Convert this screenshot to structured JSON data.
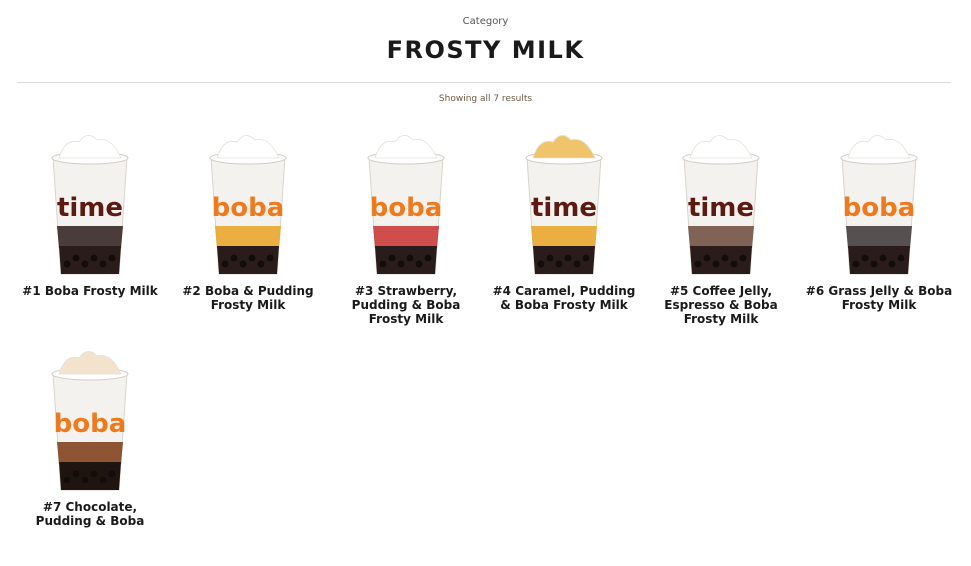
{
  "header": {
    "eyebrow": "Category",
    "title": "FROSTY MILK",
    "results": "Showing all 7 results"
  },
  "products": [
    {
      "name": "#1 Boba Frosty Milk",
      "cup_text": "time",
      "cup_text_color": "#5b1a12",
      "layers": [
        "#2a1c1a",
        "#2a1c1a"
      ],
      "topping_color": "#ffffff"
    },
    {
      "name": "#2 Boba & Pudding Frosty Milk",
      "cup_text": "boba",
      "cup_text_color": "#ef7a1e",
      "layers": [
        "#e8a321",
        "#2a1c1a"
      ],
      "topping_color": "#ffffff"
    },
    {
      "name": "#3 Strawberry, Pudding & Boba Frosty Milk",
      "cup_text": "boba",
      "cup_text_color": "#ef7a1e",
      "layers": [
        "#c8302e",
        "#2a1c1a"
      ],
      "topping_color": "#ffffff"
    },
    {
      "name": "#4 Caramel, Pudding & Boba Frosty Milk",
      "cup_text": "time",
      "cup_text_color": "#5b1a12",
      "layers": [
        "#e8a321",
        "#2a1c1a"
      ],
      "topping_color": "#f0c46a"
    },
    {
      "name": "#5 Coffee Jelly, Espresso & Boba Frosty Milk",
      "cup_text": "time",
      "cup_text_color": "#5b1a12",
      "layers": [
        "#6b4a3a",
        "#2a1c1a"
      ],
      "topping_color": "#ffffff"
    },
    {
      "name": "#6 Grass Jelly & Boba Frosty Milk",
      "cup_text": "boba",
      "cup_text_color": "#ef7a1e",
      "layers": [
        "#3a3534",
        "#2a1c1a"
      ],
      "topping_color": "#ffffff"
    },
    {
      "name": "#7 Chocolate, Pudding & Boba",
      "cup_text": "boba",
      "cup_text_color": "#ef7a1e",
      "layers": [
        "#7a3a12",
        "#1f1410"
      ],
      "topping_color": "#f3e2cc"
    }
  ]
}
